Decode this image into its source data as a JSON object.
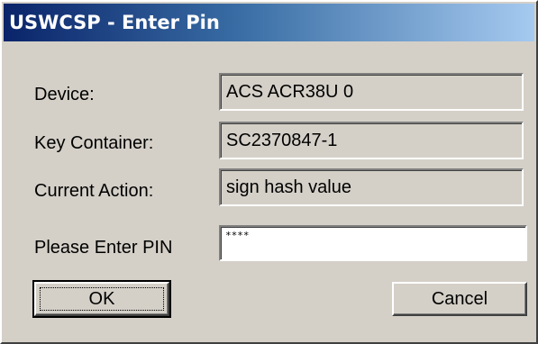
{
  "window": {
    "title": "USWCSP - Enter Pin"
  },
  "fields": {
    "device": {
      "label": "Device:",
      "value": "ACS ACR38U 0"
    },
    "key_container": {
      "label": "Key Container:",
      "value": "SC2370847-1"
    },
    "current_action": {
      "label": "Current Action:",
      "value": "sign hash value"
    }
  },
  "pin": {
    "label": "Please Enter PIN",
    "value": "****"
  },
  "buttons": {
    "ok_label": "OK",
    "cancel_label": "Cancel"
  },
  "colors": {
    "title_bar_start": "#0a246a",
    "title_bar_end": "#a6caf0",
    "dialog_face": "#d4d0c8"
  }
}
